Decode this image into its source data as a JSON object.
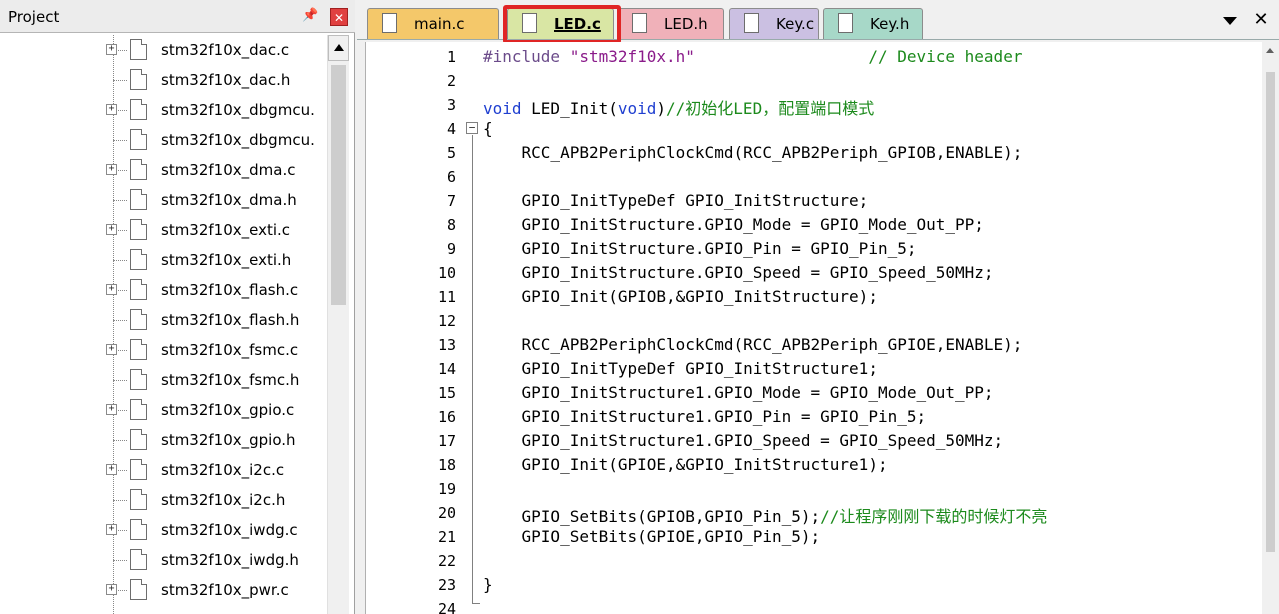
{
  "project_panel": {
    "title": "Project",
    "pin_icon": "pin-icon",
    "close_icon": "close-icon",
    "files": [
      {
        "name": "stm32f10x_dac.c",
        "expandable": true
      },
      {
        "name": "stm32f10x_dac.h",
        "expandable": false
      },
      {
        "name": "stm32f10x_dbgmcu.",
        "expandable": true
      },
      {
        "name": "stm32f10x_dbgmcu.",
        "expandable": false
      },
      {
        "name": "stm32f10x_dma.c",
        "expandable": true
      },
      {
        "name": "stm32f10x_dma.h",
        "expandable": false
      },
      {
        "name": "stm32f10x_exti.c",
        "expandable": true
      },
      {
        "name": "stm32f10x_exti.h",
        "expandable": false
      },
      {
        "name": "stm32f10x_flash.c",
        "expandable": true
      },
      {
        "name": "stm32f10x_flash.h",
        "expandable": false
      },
      {
        "name": "stm32f10x_fsmc.c",
        "expandable": true
      },
      {
        "name": "stm32f10x_fsmc.h",
        "expandable": false
      },
      {
        "name": "stm32f10x_gpio.c",
        "expandable": true
      },
      {
        "name": "stm32f10x_gpio.h",
        "expandable": false
      },
      {
        "name": "stm32f10x_i2c.c",
        "expandable": true
      },
      {
        "name": "stm32f10x_i2c.h",
        "expandable": false
      },
      {
        "name": "stm32f10x_iwdg.c",
        "expandable": true
      },
      {
        "name": "stm32f10x_iwdg.h",
        "expandable": false
      },
      {
        "name": "stm32f10x_pwr.c",
        "expandable": true
      }
    ]
  },
  "tabs": [
    {
      "id": "tab-main",
      "label": "main.c",
      "color": "#f4c86a"
    },
    {
      "id": "tab-ledc",
      "label": "LED.c",
      "color": "#d9e6a4",
      "active": true
    },
    {
      "id": "tab-ledh",
      "label": "LED.h",
      "color": "#f0b1b9"
    },
    {
      "id": "tab-keyc",
      "label": "Key.c",
      "color": "#cbc0e2"
    },
    {
      "id": "tab-keyh",
      "label": "Key.h",
      "color": "#a7d8c8"
    }
  ],
  "tab_controls": {
    "dropdown_icon": "chevron-down-icon",
    "close_label": "✕"
  },
  "highlight_color": "#e02525",
  "editor": {
    "line_numbers": [
      "1",
      "2",
      "3",
      "4",
      "5",
      "6",
      "7",
      "8",
      "9",
      "10",
      "11",
      "12",
      "13",
      "14",
      "15",
      "16",
      "17",
      "18",
      "19",
      "20",
      "21",
      "22",
      "23",
      "24"
    ],
    "lines": [
      [
        {
          "t": "#include ",
          "c": "pp"
        },
        {
          "t": "\"stm32f10x.h\"",
          "c": "str"
        },
        {
          "t": "                  // Device header",
          "c": "cm"
        }
      ],
      [],
      [
        {
          "t": "void",
          "c": "kw"
        },
        {
          "t": " LED_Init(",
          "c": ""
        },
        {
          "t": "void",
          "c": "kw"
        },
        {
          "t": ")",
          "c": ""
        },
        {
          "t": "//初始化LED，配置端口模式",
          "c": "cm"
        }
      ],
      [
        {
          "t": "{",
          "c": ""
        }
      ],
      [
        {
          "t": "    RCC_APB2PeriphClockCmd(RCC_APB2Periph_GPIOB,ENABLE);",
          "c": ""
        }
      ],
      [],
      [
        {
          "t": "    GPIO_InitTypeDef GPIO_InitStructure;",
          "c": ""
        }
      ],
      [
        {
          "t": "    GPIO_InitStructure.GPIO_Mode = GPIO_Mode_Out_PP;",
          "c": ""
        }
      ],
      [
        {
          "t": "    GPIO_InitStructure.GPIO_Pin = GPIO_Pin_5;",
          "c": ""
        }
      ],
      [
        {
          "t": "    GPIO_InitStructure.GPIO_Speed = GPIO_Speed_50MHz;",
          "c": ""
        }
      ],
      [
        {
          "t": "    GPIO_Init(GPIOB,&GPIO_InitStructure);",
          "c": ""
        }
      ],
      [],
      [
        {
          "t": "    RCC_APB2PeriphClockCmd(RCC_APB2Periph_GPIOE,ENABLE);",
          "c": ""
        }
      ],
      [
        {
          "t": "    GPIO_InitTypeDef GPIO_InitStructure1;",
          "c": ""
        }
      ],
      [
        {
          "t": "    GPIO_InitStructure1.GPIO_Mode = GPIO_Mode_Out_PP;",
          "c": ""
        }
      ],
      [
        {
          "t": "    GPIO_InitStructure1.GPIO_Pin = GPIO_Pin_5;",
          "c": ""
        }
      ],
      [
        {
          "t": "    GPIO_InitStructure1.GPIO_Speed = GPIO_Speed_50MHz;",
          "c": ""
        }
      ],
      [
        {
          "t": "    GPIO_Init(GPIOE,&GPIO_InitStructure1);",
          "c": ""
        }
      ],
      [],
      [
        {
          "t": "    GPIO_SetBits(GPIOB,GPIO_Pin_5);",
          "c": ""
        },
        {
          "t": "//让程序刚刚下载的时候灯不亮",
          "c": "cm"
        }
      ],
      [
        {
          "t": "    GPIO_SetBits(GPIOE,GPIO_Pin_5);",
          "c": ""
        }
      ],
      [],
      [
        {
          "t": "}",
          "c": ""
        }
      ],
      []
    ],
    "fold_marker": "−"
  }
}
